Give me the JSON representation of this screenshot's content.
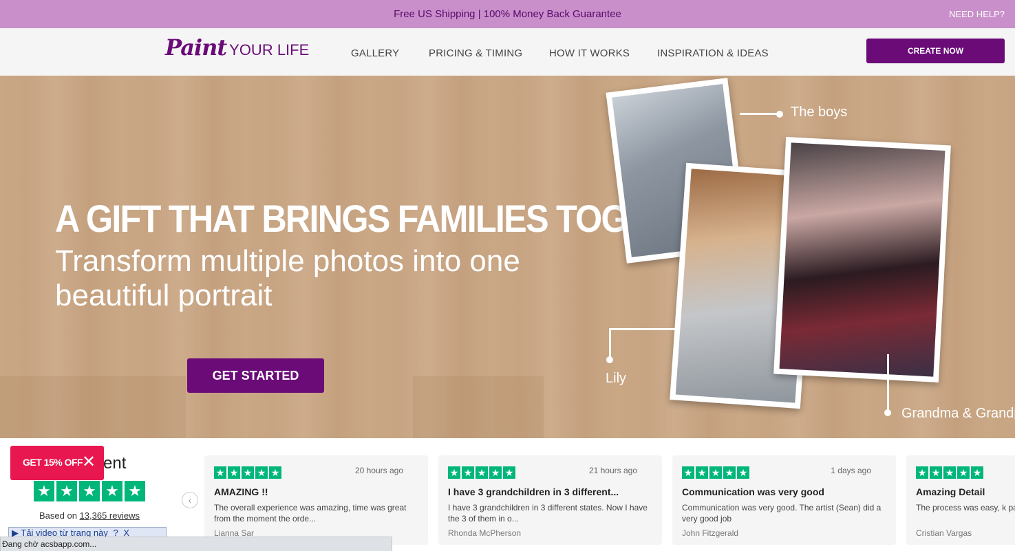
{
  "topbar": {
    "promo": "Free US Shipping | 100% Money Back Guarantee",
    "help": "NEED HELP?"
  },
  "logo": {
    "script": "Paint",
    "rest": "YOUR LIFE"
  },
  "nav": {
    "items": [
      {
        "label": "GALLERY"
      },
      {
        "label": "PRICING & TIMING"
      },
      {
        "label": "HOW IT WORKS"
      },
      {
        "label": "INSPIRATION & IDEAS"
      }
    ],
    "cta": "CREATE NOW"
  },
  "hero": {
    "title": "A GIFT THAT BRINGS FAMILIES TOGETHER",
    "subtitle": "Transform multiple photos into one beautiful portrait",
    "cta": "GET STARTED",
    "labels": {
      "boys": "The boys",
      "lily": "Lily",
      "grandparents": "Grandma & Grandp"
    }
  },
  "trust": {
    "rating_word": "ent",
    "based_prefix": "Based on ",
    "reviews_link": "13,365 reviews",
    "star": "★"
  },
  "reviews": [
    {
      "time": "20 hours ago",
      "title": "AMAZING !!",
      "text": "The overall experience was amazing, time was great from the moment the orde...",
      "author": "Lianna Sar"
    },
    {
      "time": "21 hours ago",
      "title": "I have 3 grandchildren in 3 different...",
      "text": "I have 3 grandchildren in 3 different states. Now I have the 3 of them in o...",
      "author": "Rhonda McPherson"
    },
    {
      "time": "1 days ago",
      "title": "Communication was very good",
      "text": "Communication was very good. The artist (Sean) did a very good job",
      "author": "John Fitzgerald"
    },
    {
      "time": "",
      "title": "Amazing Detail",
      "text": "The process was easy, k painting too. I LOVE the",
      "author": "Cristian Vargas"
    }
  ],
  "popup": {
    "label": "GET 15% OFF",
    "close": "✕"
  },
  "video_bar": {
    "label": "▶ Tải video từ trang này",
    "help": "?",
    "close": "X"
  },
  "status": "Đang chờ acsbapp.com..."
}
